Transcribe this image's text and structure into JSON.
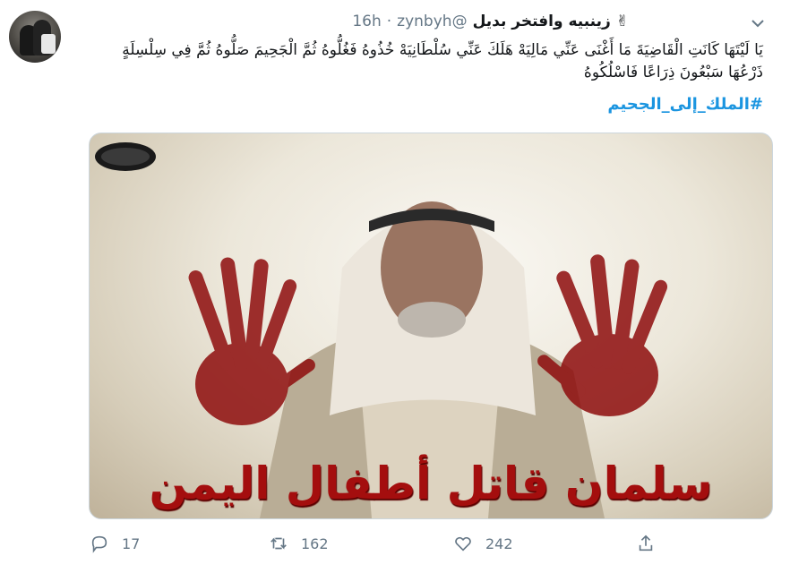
{
  "tweet": {
    "user": {
      "name": "زينبيه وافتخر بديل",
      "emoji": "✌",
      "handle": "@zynbyh",
      "separator": "·",
      "time": "16h"
    },
    "text": "يَا لَيْتَهَا كَانَتِ الْقَاضِيَةَ مَا أَغْنَى عَنِّي مَالِيَهْ هَلَكَ عَنِّي سُلْطَانِيَهْ خُذُوهُ فَغُلُّوهُ ثُمَّ الْجَحِيمَ صَلُّوهُ ثُمَّ فِي سِلْسِلَةٍ ذَرْعُهَا سَبْعُونَ ذِرَاعًا فَاسْلُكُوهُ",
    "hashtag": "#الملك_إلى_الجحيم",
    "media": {
      "caption": "سلمان قاتل أطفال اليمن",
      "colors": {
        "blood": "#8e0d0d",
        "caption": "#a40e0e"
      }
    },
    "actions": {
      "replies": "17",
      "retweets": "162",
      "likes": "242"
    },
    "icons": [
      "caret-down-icon",
      "reply-icon",
      "retweet-icon",
      "like-icon",
      "share-icon"
    ],
    "colors": {
      "accent": "#1b95e0",
      "muted": "#657786",
      "text": "#14171a"
    }
  }
}
